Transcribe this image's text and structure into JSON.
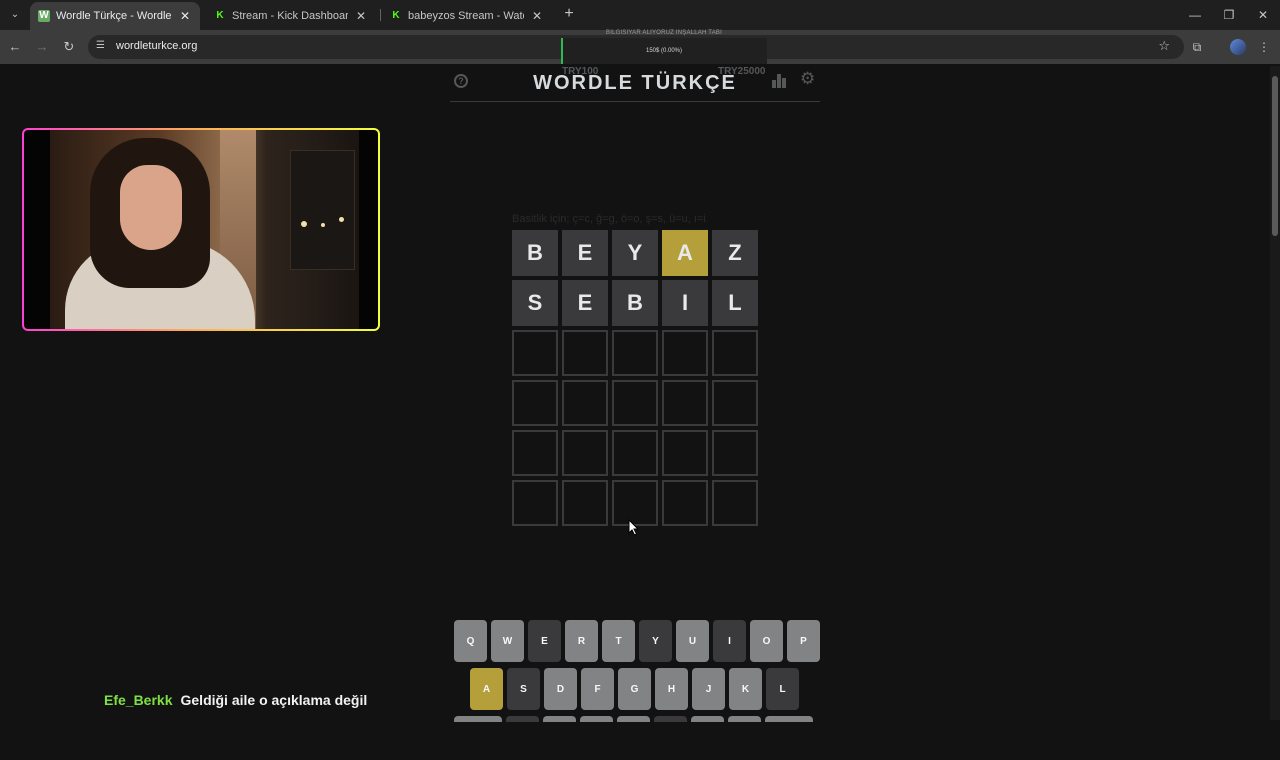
{
  "browser": {
    "tabs": [
      {
        "title": "Wordle Türkçe - Wordle Sınırsız",
        "favicon": "W",
        "favicon_color": "#6aaa64",
        "active": true
      },
      {
        "title": "Stream - Kick Dashboard",
        "favicon": "K",
        "favicon_color": "#53fc18",
        "active": false
      },
      {
        "title": "babeyzos Stream - Watch Live o",
        "favicon": "K",
        "favicon_color": "#53fc18",
        "active": false
      }
    ],
    "url": "wordleturkce.org"
  },
  "stream_overlay": {
    "donation_label": "BILGISIYAR ALIYORUZ INŞALLAH TABI",
    "donation_value": "150$ (0.00%)",
    "goal_min": "TRY100",
    "goal_max": "TRY25000",
    "progress_fraction": 0.0
  },
  "game": {
    "title": "WORDLE TÜRKÇE",
    "hint": "Basitlik için; ç=c, ğ=g, ö=o, ş=s, ü=u, ı=i",
    "board": [
      [
        {
          "l": "B",
          "s": "absent"
        },
        {
          "l": "E",
          "s": "absent"
        },
        {
          "l": "Y",
          "s": "absent"
        },
        {
          "l": "A",
          "s": "present"
        },
        {
          "l": "Z",
          "s": "absent"
        }
      ],
      [
        {
          "l": "S",
          "s": "absent"
        },
        {
          "l": "E",
          "s": "absent"
        },
        {
          "l": "B",
          "s": "absent"
        },
        {
          "l": "I",
          "s": "absent"
        },
        {
          "l": "L",
          "s": "absent"
        }
      ],
      [
        {
          "l": "",
          "s": "empty"
        },
        {
          "l": "",
          "s": "empty"
        },
        {
          "l": "",
          "s": "empty"
        },
        {
          "l": "",
          "s": "empty"
        },
        {
          "l": "",
          "s": "empty"
        }
      ],
      [
        {
          "l": "",
          "s": "empty"
        },
        {
          "l": "",
          "s": "empty"
        },
        {
          "l": "",
          "s": "empty"
        },
        {
          "l": "",
          "s": "empty"
        },
        {
          "l": "",
          "s": "empty"
        }
      ],
      [
        {
          "l": "",
          "s": "empty"
        },
        {
          "l": "",
          "s": "empty"
        },
        {
          "l": "",
          "s": "empty"
        },
        {
          "l": "",
          "s": "empty"
        },
        {
          "l": "",
          "s": "empty"
        }
      ],
      [
        {
          "l": "",
          "s": "empty"
        },
        {
          "l": "",
          "s": "empty"
        },
        {
          "l": "",
          "s": "empty"
        },
        {
          "l": "",
          "s": "empty"
        },
        {
          "l": "",
          "s": "empty"
        }
      ]
    ],
    "keyboard": [
      [
        {
          "k": "Q",
          "s": "unused"
        },
        {
          "k": "W",
          "s": "unused"
        },
        {
          "k": "E",
          "s": "absent"
        },
        {
          "k": "R",
          "s": "unused"
        },
        {
          "k": "T",
          "s": "unused"
        },
        {
          "k": "Y",
          "s": "absent"
        },
        {
          "k": "U",
          "s": "unused"
        },
        {
          "k": "I",
          "s": "absent"
        },
        {
          "k": "O",
          "s": "unused"
        },
        {
          "k": "P",
          "s": "unused"
        }
      ],
      [
        {
          "k": "A",
          "s": "present"
        },
        {
          "k": "S",
          "s": "absent"
        },
        {
          "k": "D",
          "s": "unused"
        },
        {
          "k": "F",
          "s": "unused"
        },
        {
          "k": "G",
          "s": "unused"
        },
        {
          "k": "H",
          "s": "unused"
        },
        {
          "k": "J",
          "s": "unused"
        },
        {
          "k": "K",
          "s": "unused"
        },
        {
          "k": "L",
          "s": "absent"
        }
      ],
      [
        {
          "k": "",
          "s": "unused",
          "w": "wide"
        },
        {
          "k": "",
          "s": "absent"
        },
        {
          "k": "",
          "s": "unused"
        },
        {
          "k": "",
          "s": "unused"
        },
        {
          "k": "",
          "s": "unused"
        },
        {
          "k": "",
          "s": "absent"
        },
        {
          "k": "",
          "s": "unused"
        },
        {
          "k": "",
          "s": "unused"
        },
        {
          "k": "",
          "s": "unused",
          "w": "wide"
        }
      ]
    ]
  },
  "chat": {
    "username": "Efe_Berkk",
    "message": "Geldiği aile o açıklama değil"
  },
  "colors": {
    "absent": "#3a3a3c",
    "present": "#b59f3b",
    "correct": "#538d4e",
    "unused": "#818384",
    "chat_user": "#7ee043"
  }
}
